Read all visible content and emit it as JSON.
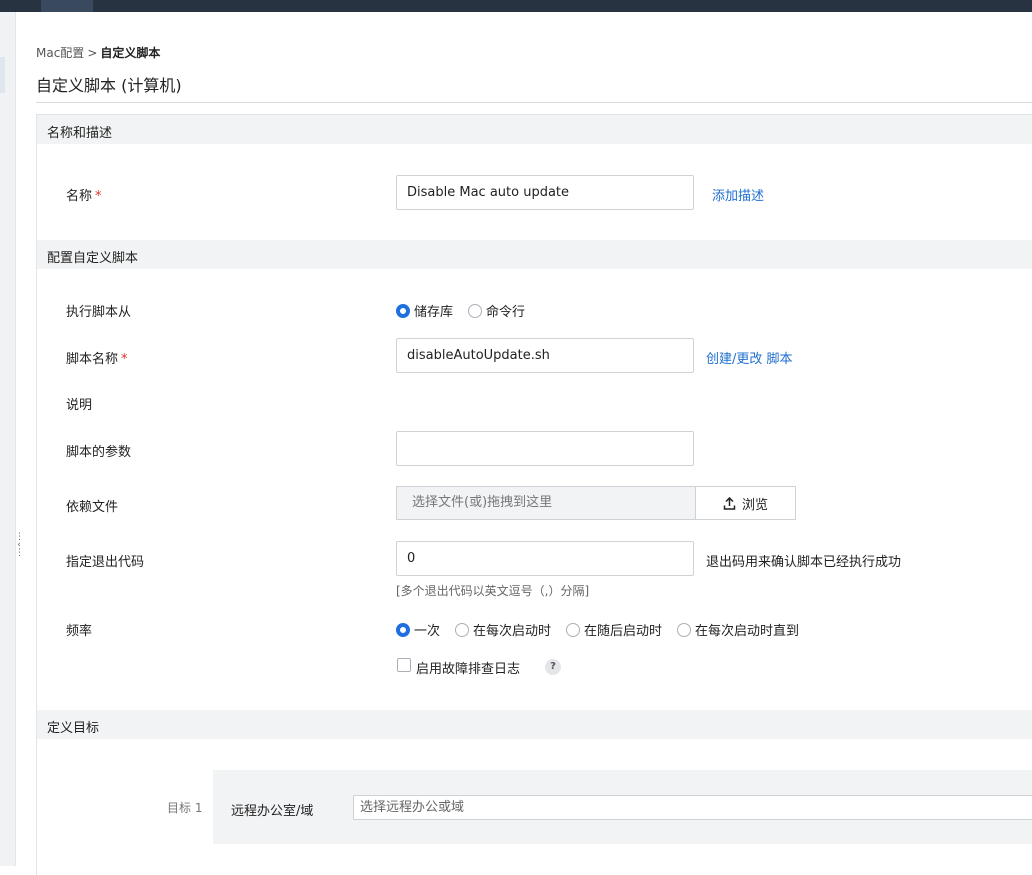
{
  "breadcrumb": {
    "parent": "Mac配置",
    "separator": ">",
    "current": "自定义脚本"
  },
  "page_title": "自定义脚本 (计算机)",
  "sections": {
    "name_desc": "名称和描述",
    "configure": "配置自定义脚本",
    "targets": "定义目标"
  },
  "name_field": {
    "label": "名称",
    "required_mark": "*",
    "value": "Disable Mac auto update",
    "add_desc_link": "添加描述"
  },
  "execute_from": {
    "label": "执行脚本从",
    "options": [
      {
        "label": "储存库",
        "selected": true
      },
      {
        "label": "命令行",
        "selected": false
      }
    ]
  },
  "script_name": {
    "label": "脚本名称",
    "required_mark": "*",
    "value": "disableAutoUpdate.sh",
    "link": "创建/更改 脚本"
  },
  "description_label": "说明",
  "script_args": {
    "label": "脚本的参数",
    "value": ""
  },
  "dependency": {
    "label": "依赖文件",
    "placeholder": "选择文件(或)拖拽到这里",
    "browse_label": "浏览"
  },
  "exit_code": {
    "label": "指定退出代码",
    "value": "0",
    "note": "退出码用来确认脚本已经执行成功",
    "hint": "[多个退出代码以英文逗号（,）分隔]"
  },
  "frequency": {
    "label": "频率",
    "options": [
      {
        "label": "一次",
        "selected": true
      },
      {
        "label": "在每次启动时",
        "selected": false
      },
      {
        "label": "在随后启动时",
        "selected": false
      },
      {
        "label": "在每次启动时直到",
        "selected": false
      }
    ]
  },
  "troubleshoot": {
    "label": "启用故障排查日志",
    "checked": false,
    "help": "?"
  },
  "target": {
    "index_label": "目标 1",
    "name": "远程办公室/域",
    "placeholder": "选择远程办公或域"
  },
  "colors": {
    "accent": "#1f6fe0",
    "link": "#1f6fd1",
    "topbar": "#283342",
    "required": "#e0312e"
  }
}
